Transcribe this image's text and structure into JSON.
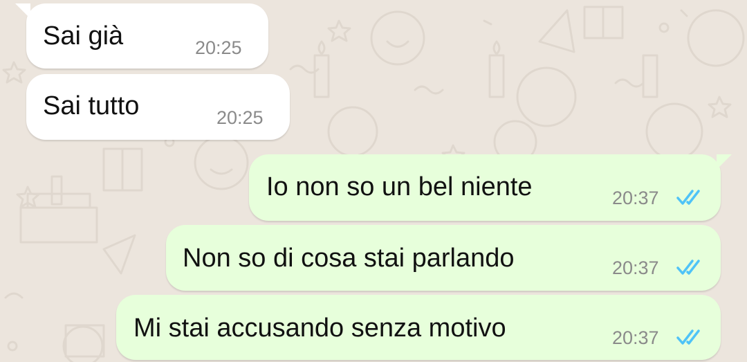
{
  "conversation": {
    "incoming": [
      {
        "text": "Sai già",
        "time": "20:25"
      },
      {
        "text": "Sai tutto",
        "time": "20:25"
      }
    ],
    "outgoing": [
      {
        "text": "Io non so un bel niente",
        "time": "20:37",
        "status": "read"
      },
      {
        "text": "Non so di cosa stai parlando",
        "time": "20:37",
        "status": "read"
      },
      {
        "text": "Mi stai accusando senza motivo",
        "time": "20:37",
        "status": "read"
      }
    ]
  },
  "icons": {
    "read_receipt": "double-check-icon",
    "background": "doodle-pattern"
  },
  "colors": {
    "chat_background": "#ece5dd",
    "incoming_bubble": "#ffffff",
    "outgoing_bubble": "#e7ffdb",
    "read_tick": "#4fc3f7",
    "timestamp": "#8a8a8a"
  }
}
